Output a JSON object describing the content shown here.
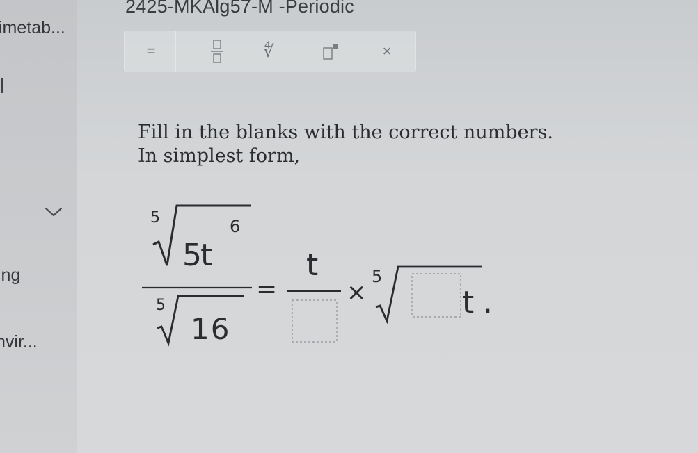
{
  "header": {
    "title": "2425-MKAlg57-M -Periodic"
  },
  "sidebar": {
    "items": [
      {
        "label": "imetab..."
      },
      {
        "label": "ing"
      },
      {
        "label": "nvir..."
      }
    ]
  },
  "toolbar": {
    "buttons": [
      {
        "icon": "equals-icon",
        "label": "="
      },
      {
        "icon": "fraction-icon",
        "label": ""
      },
      {
        "icon": "nth-root-icon",
        "label": "∜"
      },
      {
        "icon": "superscript-icon",
        "label": ""
      },
      {
        "icon": "times-icon",
        "label": "×"
      }
    ]
  },
  "problem": {
    "instruction": "Fill in the blanks with the correct numbers.",
    "subinstruction": "In simplest form,",
    "expression": {
      "numerator_index": "5",
      "numerator_radicand_coefficient": "5",
      "numerator_radicand_variable": "t",
      "numerator_radicand_exponent": "6",
      "denominator_index": "5",
      "denominator_radicand": "16",
      "equals": "=",
      "rhs_fraction_numerator": "t",
      "times": "×",
      "rhs_root_index": "5",
      "rhs_radicand_variable": "t",
      "period": "."
    }
  }
}
